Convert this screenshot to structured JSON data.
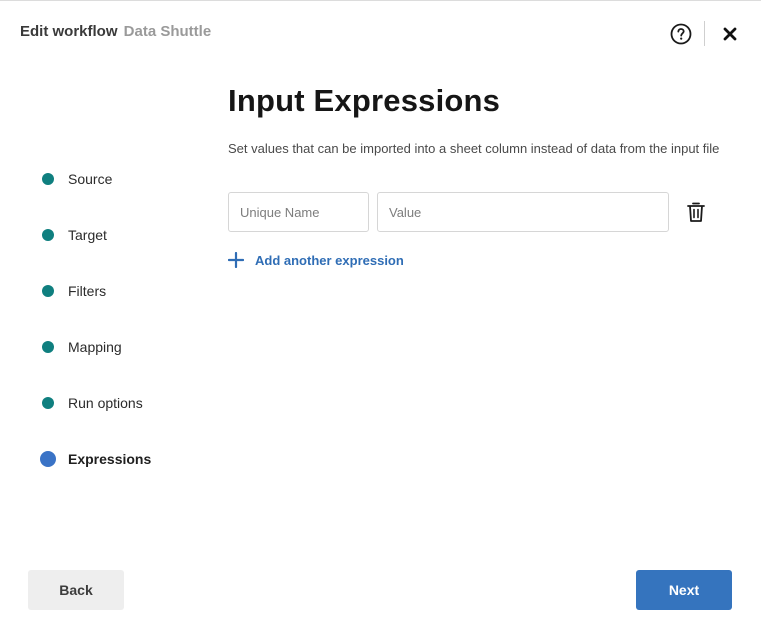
{
  "header": {
    "title": "Edit workflow",
    "subtitle": "Data Shuttle",
    "help_icon": "question-circle-icon",
    "close_icon": "close-x-icon"
  },
  "steps": [
    {
      "label": "Source",
      "state": "complete"
    },
    {
      "label": "Target",
      "state": "complete"
    },
    {
      "label": "Filters",
      "state": "complete"
    },
    {
      "label": "Mapping",
      "state": "complete"
    },
    {
      "label": "Run options",
      "state": "complete"
    },
    {
      "label": "Expressions",
      "state": "active"
    }
  ],
  "main": {
    "title": "Input Expressions",
    "description": "Set values that can be imported into a sheet column instead of data from the input file",
    "expression": {
      "name_value": "",
      "name_placeholder": "Unique Name",
      "value_value": "",
      "value_placeholder": "Value",
      "delete_icon": "trash-icon"
    },
    "add_label": "Add another expression",
    "add_icon": "plus-icon"
  },
  "footer": {
    "back_label": "Back",
    "next_label": "Next"
  },
  "colors": {
    "step_complete": "#0f7f7f",
    "step_active": "#3a73c6",
    "link": "#2f6db5",
    "primary_button": "#3574be",
    "secondary_button": "#eeeeee"
  }
}
